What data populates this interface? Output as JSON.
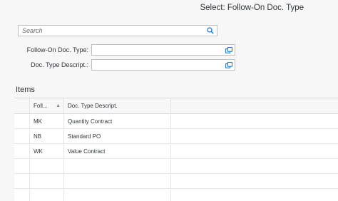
{
  "dialog": {
    "title": "Select: Follow-On Doc. Type"
  },
  "search": {
    "placeholder": "Search"
  },
  "fields": {
    "follow_on_label": "Follow-On Doc. Type:",
    "descript_label": "Doc. Type Descript.:"
  },
  "items": {
    "title": "Items",
    "columns": {
      "col1": "Foll...",
      "col2": "Doc. Type Descript."
    },
    "rows": [
      {
        "code": "MK",
        "desc": "Quantity Contract"
      },
      {
        "code": "NB",
        "desc": "Standard PO"
      },
      {
        "code": "WK",
        "desc": "Value Contract"
      }
    ]
  },
  "icons": {
    "search": "search-icon",
    "value_help": "value-help-icon",
    "sort": "sort-ascending-icon"
  },
  "colors": {
    "background": "#f7f7f7",
    "icon": "#0a6ed1"
  }
}
